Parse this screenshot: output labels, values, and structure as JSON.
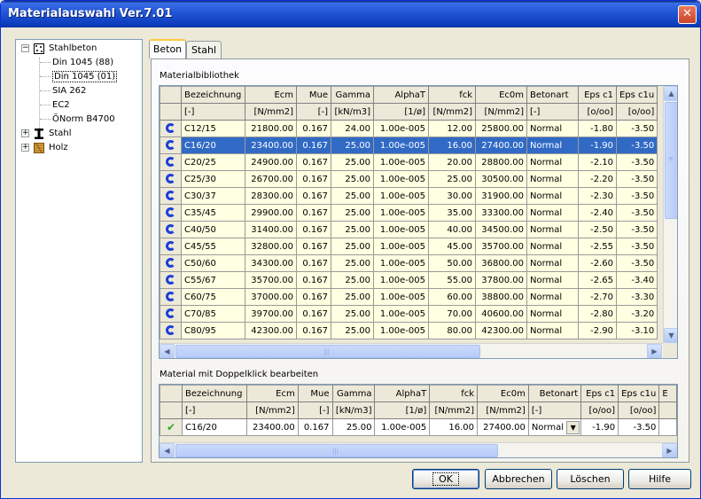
{
  "window": {
    "title": "Materialauswahl Ver.7.01",
    "close_glyph": "✕"
  },
  "tree": {
    "nodes": [
      {
        "label": "Stahlbeton",
        "expander": "−",
        "icon": "concrete-icon"
      },
      {
        "label": "Din 1045 (88)"
      },
      {
        "label": "Din 1045 (01)"
      },
      {
        "label": "SIA 262"
      },
      {
        "label": "EC2"
      },
      {
        "label": "ÖNorm B4700"
      },
      {
        "label": "Stahl",
        "expander": "+",
        "icon": "i-beam-icon"
      },
      {
        "label": "Holz",
        "expander": "+",
        "icon": "wood-icon"
      }
    ]
  },
  "tabs": [
    {
      "label": "Beton"
    },
    {
      "label": "Stahl"
    }
  ],
  "library": {
    "label": "Materialbibliothek",
    "columns": [
      "Bezeichnung",
      "Ecm",
      "Mue",
      "Gamma",
      "AlphaT",
      "fck",
      "Ec0m",
      "Betonart",
      "Eps c1",
      "Eps c1u"
    ],
    "units": [
      "[-]",
      "[N/mm2]",
      "[-]",
      "[kN/m3]",
      "[1/ø]",
      "[N/mm2]",
      "[N/mm2]",
      "[-]",
      "[o/oo]",
      "[o/oo]"
    ],
    "rows": [
      [
        "C12/15",
        "21800.00",
        "0.167",
        "24.00",
        "1.00e-005",
        "12.00",
        "25800.00",
        "Normal",
        "-1.80",
        "-3.50"
      ],
      [
        "C16/20",
        "23400.00",
        "0.167",
        "25.00",
        "1.00e-005",
        "16.00",
        "27400.00",
        "Normal",
        "-1.90",
        "-3.50"
      ],
      [
        "C20/25",
        "24900.00",
        "0.167",
        "25.00",
        "1.00e-005",
        "20.00",
        "28800.00",
        "Normal",
        "-2.10",
        "-3.50"
      ],
      [
        "C25/30",
        "26700.00",
        "0.167",
        "25.00",
        "1.00e-005",
        "25.00",
        "30500.00",
        "Normal",
        "-2.20",
        "-3.50"
      ],
      [
        "C30/37",
        "28300.00",
        "0.167",
        "25.00",
        "1.00e-005",
        "30.00",
        "31900.00",
        "Normal",
        "-2.30",
        "-3.50"
      ],
      [
        "C35/45",
        "29900.00",
        "0.167",
        "25.00",
        "1.00e-005",
        "35.00",
        "33300.00",
        "Normal",
        "-2.40",
        "-3.50"
      ],
      [
        "C40/50",
        "31400.00",
        "0.167",
        "25.00",
        "1.00e-005",
        "40.00",
        "34500.00",
        "Normal",
        "-2.50",
        "-3.50"
      ],
      [
        "C45/55",
        "32800.00",
        "0.167",
        "25.00",
        "1.00e-005",
        "45.00",
        "35700.00",
        "Normal",
        "-2.55",
        "-3.50"
      ],
      [
        "C50/60",
        "34300.00",
        "0.167",
        "25.00",
        "1.00e-005",
        "50.00",
        "36800.00",
        "Normal",
        "-2.60",
        "-3.50"
      ],
      [
        "C55/67",
        "35700.00",
        "0.167",
        "25.00",
        "1.00e-005",
        "55.00",
        "37800.00",
        "Normal",
        "-2.65",
        "-3.40"
      ],
      [
        "C60/75",
        "37000.00",
        "0.167",
        "25.00",
        "1.00e-005",
        "60.00",
        "38800.00",
        "Normal",
        "-2.70",
        "-3.30"
      ],
      [
        "C70/85",
        "39700.00",
        "0.167",
        "25.00",
        "1.00e-005",
        "70.00",
        "40600.00",
        "Normal",
        "-2.80",
        "-3.20"
      ],
      [
        "C80/95",
        "42300.00",
        "0.167",
        "25.00",
        "1.00e-005",
        "80.00",
        "42300.00",
        "Normal",
        "-2.90",
        "-3.10"
      ]
    ],
    "selected_row": 1
  },
  "editor": {
    "label": "Material mit Doppelklick bearbeiten",
    "columns": [
      "Bezeichnung",
      "Ecm",
      "Mue",
      "Gamma",
      "AlphaT",
      "fck",
      "Ec0m",
      "Betonart",
      "Eps c1",
      "Eps c1u"
    ],
    "units": [
      "[-]",
      "[N/mm2]",
      "[-]",
      "[kN/m3]",
      "[1/ø]",
      "[N/mm2]",
      "[N/mm2]",
      "[-]",
      "[o/oo]",
      "[o/oo]"
    ],
    "row": [
      "C16/20",
      "23400.00",
      "0.167",
      "25.00",
      "1.00e-005",
      "16.00",
      "27400.00",
      "Normal",
      "-1.90",
      "-3.50"
    ],
    "check_glyph": "✔"
  },
  "buttons": {
    "ok": "OK",
    "cancel": "Abbrechen",
    "delete": "Löschen",
    "help": "Hilfe"
  },
  "colors": {
    "selection": "#316AC5",
    "row_bg": "#FFFFE1",
    "title_bar": "#0A246A"
  }
}
